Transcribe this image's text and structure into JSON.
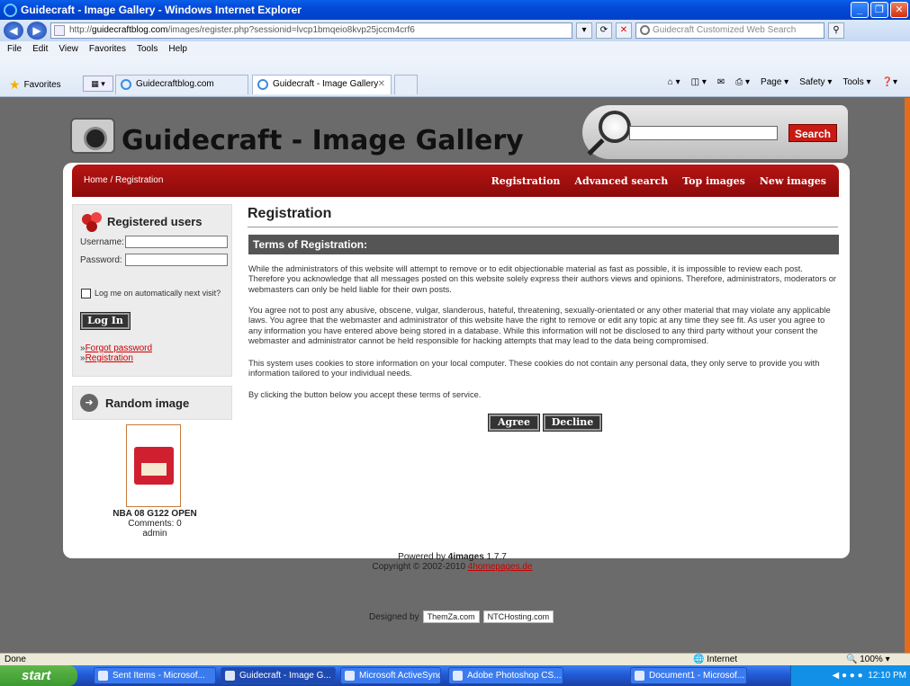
{
  "window": {
    "title": "Guidecraft - Image Gallery - Windows Internet Explorer"
  },
  "browser": {
    "url_host": "guidecraftblog.com",
    "url_prefix": "http://",
    "url_path": "/images/register.php?sessionid=lvcp1bmqeio8kvp25jccm4crf6",
    "search_placeholder": "Guidecraft Customized Web Search",
    "menu": [
      "File",
      "Edit",
      "View",
      "Favorites",
      "Tools",
      "Help"
    ],
    "favorites_label": "Favorites",
    "tabs": [
      {
        "label": "Guidecraftblog.com"
      },
      {
        "label": "Guidecraft - Image Gallery"
      }
    ],
    "commands": [
      "Page ▾",
      "Safety ▾",
      "Tools ▾"
    ]
  },
  "site": {
    "title": "Guidecraft - Image Gallery",
    "search_button": "Search",
    "breadcrumb_home": "Home",
    "breadcrumb_current": "/ Registration",
    "nav_links": [
      "Registration",
      "Advanced search",
      "Top images",
      "New images"
    ]
  },
  "login": {
    "heading": "Registered users",
    "username_label": "Username:",
    "password_label": "Password:",
    "remember_label": "Log me on automatically next visit?",
    "button": "Log In",
    "forgot_link": "Forgot password",
    "register_link": "Registration",
    "link_prefix": "»"
  },
  "random_image": {
    "heading": "Random image",
    "name": "NBA 08 G122 OPEN",
    "comments": "Comments: 0",
    "user": "admin"
  },
  "main": {
    "title": "Registration",
    "terms_heading": "Terms of Registration:",
    "paragraphs": [
      "While the administrators of this website will attempt to remove or to edit objectionable material as fast as possible, it is impossible to review each post. Therefore you acknowledge that all messages posted on this website solely express their authors views and opinions. Therefore, administrators, moderators or webmasters can only be held liable for their own posts.",
      "You agree not to post any abusive, obscene, vulgar, slanderous, hateful, threatening, sexually-orientated or any other material that may violate any applicable laws. You agree that the webmaster and administrator of this website have the right to remove or edit any topic at any time they see fit. As user you agree to any information you have entered above being stored in a database. While this information will not be disclosed to any third party without your consent the webmaster and administrator cannot be held responsible for hacking attempts that may lead to the data being compromised.",
      "This system uses cookies to store information on your local computer. These cookies do not contain any personal data, they only serve to provide you with information tailored to your individual needs.",
      "By clicking the button below you accept these terms of service."
    ],
    "agree": "Agree",
    "decline": "Decline"
  },
  "footer": {
    "powered_prefix": "Powered by",
    "powered_product": "4images",
    "powered_version": "1.7.7",
    "copyright": "Copyright © 2002-2010",
    "copyright_link": "4homepages.de",
    "designed_by": "Designed by",
    "badge1": "ThemZa.com",
    "badge2": "NTCHosting.com"
  },
  "status": {
    "text": "Done",
    "zone": "Internet",
    "zoom": "100%"
  },
  "taskbar": {
    "start": "start",
    "items": [
      {
        "label": "Sent Items - Microsof..."
      },
      {
        "label": "Guidecraft - Image G..."
      },
      {
        "label": "Microsoft ActiveSync"
      },
      {
        "label": "Adobe Photoshop CS..."
      },
      {
        "label": "Document1 - Microsof..."
      }
    ],
    "clock": "12:10 PM"
  },
  "colors": {
    "nav_red": "#a81010",
    "search_red": "#c81a12",
    "scroll_orange": "#e36c1a",
    "terms_bar": "#555555"
  }
}
